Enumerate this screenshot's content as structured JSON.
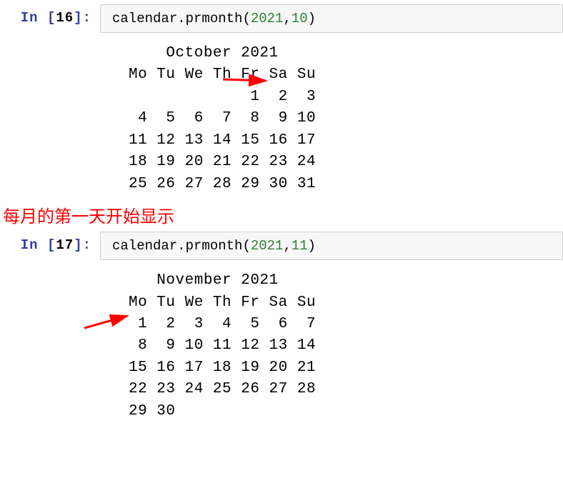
{
  "cells": {
    "first": {
      "prompt_prefix": "In [",
      "prompt_number": "16",
      "prompt_suffix": "]:",
      "code_obj": "calendar",
      "code_method": ".prmonth",
      "arg1": "2021",
      "arg2": "10"
    },
    "second": {
      "prompt_prefix": "In [",
      "prompt_number": "17",
      "prompt_suffix": "]:",
      "code_obj": "calendar",
      "code_method": ".prmonth",
      "arg1": "2021",
      "arg2": "11"
    }
  },
  "calendars": {
    "oct": {
      "title": "    October 2021",
      "header": "Mo Tu We Th Fr Sa Su",
      "l1": "             1  2  3",
      "l2": " 4  5  6  7  8  9 10",
      "l3": "11 12 13 14 15 16 17",
      "l4": "18 19 20 21 22 23 24",
      "l5": "25 26 27 28 29 30 31"
    },
    "nov": {
      "title": "   November 2021",
      "header": "Mo Tu We Th Fr Sa Su",
      "l1": " 1  2  3  4  5  6  7",
      "l2": " 8  9 10 11 12 13 14",
      "l3": "15 16 17 18 19 20 21",
      "l4": "22 23 24 25 26 27 28",
      "l5": "29 30"
    }
  },
  "annotation_text": "每月的第一天开始显示",
  "chart_data": {
    "type": "table",
    "calendars": [
      {
        "title": "October 2021",
        "weekday_header": [
          "Mo",
          "Tu",
          "We",
          "Th",
          "Fr",
          "Sa",
          "Su"
        ],
        "weeks": [
          [
            null,
            null,
            null,
            null,
            1,
            2,
            3
          ],
          [
            4,
            5,
            6,
            7,
            8,
            9,
            10
          ],
          [
            11,
            12,
            13,
            14,
            15,
            16,
            17
          ],
          [
            18,
            19,
            20,
            21,
            22,
            23,
            24
          ],
          [
            25,
            26,
            27,
            28,
            29,
            30,
            31
          ]
        ],
        "first_day_highlight": 1
      },
      {
        "title": "November 2021",
        "weekday_header": [
          "Mo",
          "Tu",
          "We",
          "Th",
          "Fr",
          "Sa",
          "Su"
        ],
        "weeks": [
          [
            1,
            2,
            3,
            4,
            5,
            6,
            7
          ],
          [
            8,
            9,
            10,
            11,
            12,
            13,
            14
          ],
          [
            15,
            16,
            17,
            18,
            19,
            20,
            21
          ],
          [
            22,
            23,
            24,
            25,
            26,
            27,
            28
          ],
          [
            29,
            30,
            null,
            null,
            null,
            null,
            null
          ]
        ],
        "first_day_highlight": 1
      }
    ]
  }
}
